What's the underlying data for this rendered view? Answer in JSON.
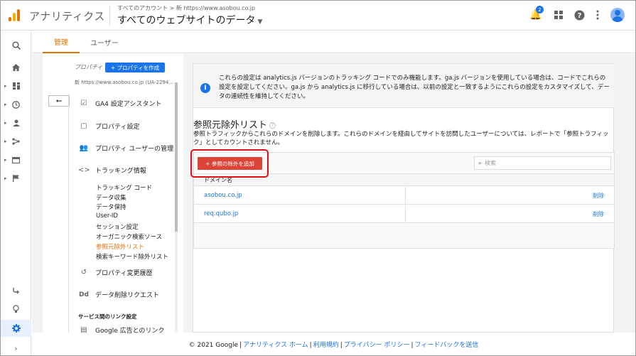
{
  "header": {
    "app_name": "アナリティクス",
    "breadcrumb": "すべてのアカウント > 新 https://www.asobou.co.jp",
    "account_title": "すべてのウェブサイトのデータ",
    "notification_count": "2"
  },
  "tabs": [
    {
      "label": "管理"
    },
    {
      "label": "ユーザー"
    }
  ],
  "property": {
    "label": "プロパティ",
    "create_button": "+ プロパティを作成",
    "url": "新 https://www.asobou.co.jp (UA-2294..."
  },
  "nav": {
    "ga4": "GA4 設定アシスタント",
    "settings": "プロパティ設定",
    "user_mgmt": "プロパティ ユーザーの管理",
    "tracking": "トラッキング情報",
    "sub_items": [
      "トラッキング コード",
      "データ収集",
      "データ保持",
      "User-ID",
      "セッション設定",
      "オーガニック検索ソース",
      "参照元除外リスト",
      "検索キーワード除外リスト"
    ],
    "history": "プロパティ変更履歴",
    "data_delete": "データ削除リクエスト",
    "section_header": "サービス間のリンク設定",
    "google_ads": "Google 広告とのリンク"
  },
  "info": {
    "text": "これらの設定は analytics.js バージョンのトラッキング コードでのみ機能します。ga.js バージョンを使用している場合は、コードでこれらの設定を設定してください。ga.js から analytics.js に移行している場合は、以前の設定と一致するようにこれらの設定をカスタマイズして、データの連続性を維持してください。"
  },
  "referral": {
    "title": "参照元除外リスト",
    "description": "参照トラフィックからこれらのドメインを削除します。これらのドメインを経由してサイトを訪問したユーザーについては、レポートで「参照トラフィック」としてカウントされません。",
    "add_button": "+ 参照の除外を追加",
    "search_placeholder": "検索",
    "column_header": "ドメイン名",
    "rows": [
      {
        "domain": "asobou.co.jp",
        "action": "削除"
      },
      {
        "domain": "req.qubo.jp",
        "action": "削除"
      }
    ]
  },
  "footer": {
    "copyright": "© 2021 Google",
    "links": [
      "アナリティクス ホーム",
      "利用規約",
      "プライバシー ポリシー",
      "フィードバックを送信"
    ]
  },
  "colors": {
    "accent": "#e37400",
    "link": "#1a73e8",
    "add_button": "#db4437",
    "highlight": "#e01010"
  }
}
